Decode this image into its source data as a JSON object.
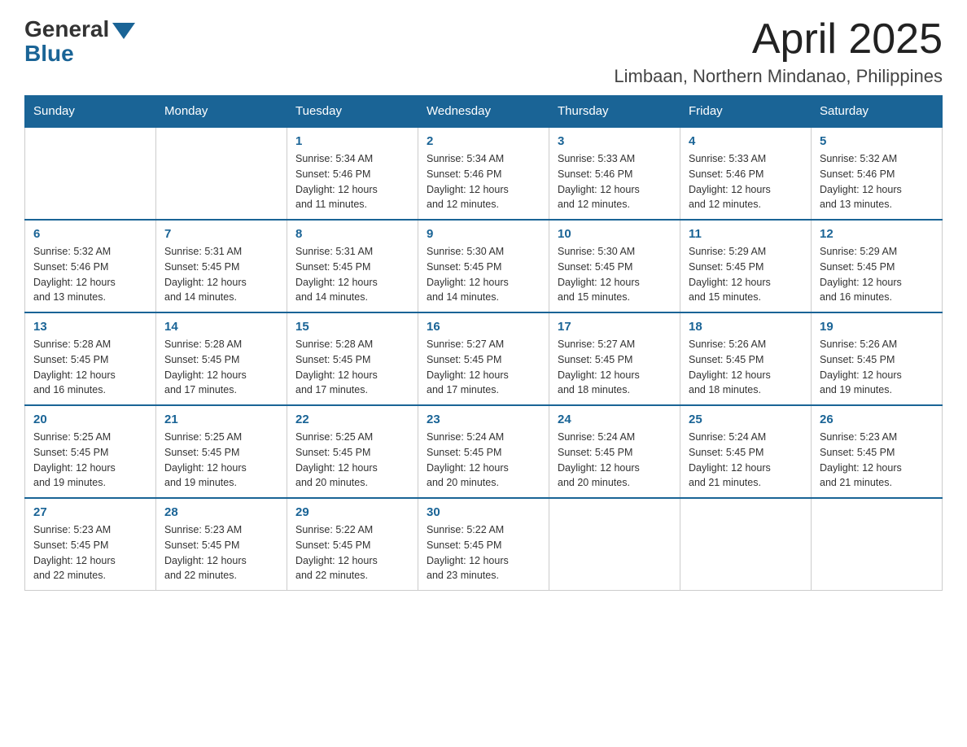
{
  "logo": {
    "general": "General",
    "blue": "Blue"
  },
  "title": "April 2025",
  "location": "Limbaan, Northern Mindanao, Philippines",
  "days_of_week": [
    "Sunday",
    "Monday",
    "Tuesday",
    "Wednesday",
    "Thursday",
    "Friday",
    "Saturday"
  ],
  "weeks": [
    [
      {
        "day": "",
        "info": ""
      },
      {
        "day": "",
        "info": ""
      },
      {
        "day": "1",
        "info": "Sunrise: 5:34 AM\nSunset: 5:46 PM\nDaylight: 12 hours\nand 11 minutes."
      },
      {
        "day": "2",
        "info": "Sunrise: 5:34 AM\nSunset: 5:46 PM\nDaylight: 12 hours\nand 12 minutes."
      },
      {
        "day": "3",
        "info": "Sunrise: 5:33 AM\nSunset: 5:46 PM\nDaylight: 12 hours\nand 12 minutes."
      },
      {
        "day": "4",
        "info": "Sunrise: 5:33 AM\nSunset: 5:46 PM\nDaylight: 12 hours\nand 12 minutes."
      },
      {
        "day": "5",
        "info": "Sunrise: 5:32 AM\nSunset: 5:46 PM\nDaylight: 12 hours\nand 13 minutes."
      }
    ],
    [
      {
        "day": "6",
        "info": "Sunrise: 5:32 AM\nSunset: 5:46 PM\nDaylight: 12 hours\nand 13 minutes."
      },
      {
        "day": "7",
        "info": "Sunrise: 5:31 AM\nSunset: 5:45 PM\nDaylight: 12 hours\nand 14 minutes."
      },
      {
        "day": "8",
        "info": "Sunrise: 5:31 AM\nSunset: 5:45 PM\nDaylight: 12 hours\nand 14 minutes."
      },
      {
        "day": "9",
        "info": "Sunrise: 5:30 AM\nSunset: 5:45 PM\nDaylight: 12 hours\nand 14 minutes."
      },
      {
        "day": "10",
        "info": "Sunrise: 5:30 AM\nSunset: 5:45 PM\nDaylight: 12 hours\nand 15 minutes."
      },
      {
        "day": "11",
        "info": "Sunrise: 5:29 AM\nSunset: 5:45 PM\nDaylight: 12 hours\nand 15 minutes."
      },
      {
        "day": "12",
        "info": "Sunrise: 5:29 AM\nSunset: 5:45 PM\nDaylight: 12 hours\nand 16 minutes."
      }
    ],
    [
      {
        "day": "13",
        "info": "Sunrise: 5:28 AM\nSunset: 5:45 PM\nDaylight: 12 hours\nand 16 minutes."
      },
      {
        "day": "14",
        "info": "Sunrise: 5:28 AM\nSunset: 5:45 PM\nDaylight: 12 hours\nand 17 minutes."
      },
      {
        "day": "15",
        "info": "Sunrise: 5:28 AM\nSunset: 5:45 PM\nDaylight: 12 hours\nand 17 minutes."
      },
      {
        "day": "16",
        "info": "Sunrise: 5:27 AM\nSunset: 5:45 PM\nDaylight: 12 hours\nand 17 minutes."
      },
      {
        "day": "17",
        "info": "Sunrise: 5:27 AM\nSunset: 5:45 PM\nDaylight: 12 hours\nand 18 minutes."
      },
      {
        "day": "18",
        "info": "Sunrise: 5:26 AM\nSunset: 5:45 PM\nDaylight: 12 hours\nand 18 minutes."
      },
      {
        "day": "19",
        "info": "Sunrise: 5:26 AM\nSunset: 5:45 PM\nDaylight: 12 hours\nand 19 minutes."
      }
    ],
    [
      {
        "day": "20",
        "info": "Sunrise: 5:25 AM\nSunset: 5:45 PM\nDaylight: 12 hours\nand 19 minutes."
      },
      {
        "day": "21",
        "info": "Sunrise: 5:25 AM\nSunset: 5:45 PM\nDaylight: 12 hours\nand 19 minutes."
      },
      {
        "day": "22",
        "info": "Sunrise: 5:25 AM\nSunset: 5:45 PM\nDaylight: 12 hours\nand 20 minutes."
      },
      {
        "day": "23",
        "info": "Sunrise: 5:24 AM\nSunset: 5:45 PM\nDaylight: 12 hours\nand 20 minutes."
      },
      {
        "day": "24",
        "info": "Sunrise: 5:24 AM\nSunset: 5:45 PM\nDaylight: 12 hours\nand 20 minutes."
      },
      {
        "day": "25",
        "info": "Sunrise: 5:24 AM\nSunset: 5:45 PM\nDaylight: 12 hours\nand 21 minutes."
      },
      {
        "day": "26",
        "info": "Sunrise: 5:23 AM\nSunset: 5:45 PM\nDaylight: 12 hours\nand 21 minutes."
      }
    ],
    [
      {
        "day": "27",
        "info": "Sunrise: 5:23 AM\nSunset: 5:45 PM\nDaylight: 12 hours\nand 22 minutes."
      },
      {
        "day": "28",
        "info": "Sunrise: 5:23 AM\nSunset: 5:45 PM\nDaylight: 12 hours\nand 22 minutes."
      },
      {
        "day": "29",
        "info": "Sunrise: 5:22 AM\nSunset: 5:45 PM\nDaylight: 12 hours\nand 22 minutes."
      },
      {
        "day": "30",
        "info": "Sunrise: 5:22 AM\nSunset: 5:45 PM\nDaylight: 12 hours\nand 23 minutes."
      },
      {
        "day": "",
        "info": ""
      },
      {
        "day": "",
        "info": ""
      },
      {
        "day": "",
        "info": ""
      }
    ]
  ]
}
